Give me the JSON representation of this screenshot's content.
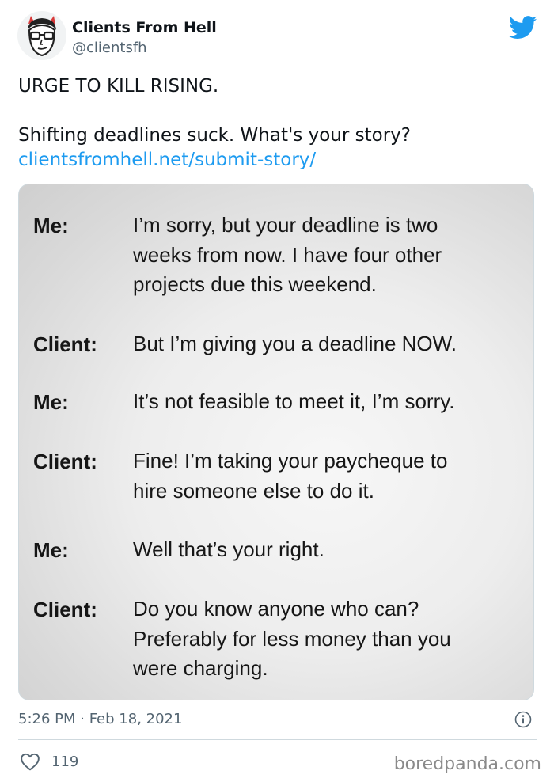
{
  "author": {
    "display_name": "Clients From Hell",
    "handle": "@clientsfh",
    "avatar_icon": "avatar-cartoon-face-with-horns",
    "platform_icon": "twitter-bird-icon",
    "accent_color": "#1d9bf0"
  },
  "tweet": {
    "line1": "URGE TO KILL RISING.",
    "line2": "Shifting deadlines suck. What's your story?",
    "link": "clientsfromhell.net/submit-story/"
  },
  "conversation": [
    {
      "speaker": "Me:",
      "lines": [
        "I’m sorry, but your deadline is two",
        "weeks from now. I have four other",
        "projects due this weekend."
      ]
    },
    {
      "speaker": "Client:",
      "lines": [
        "But I’m giving you a deadline NOW."
      ]
    },
    {
      "speaker": "Me:",
      "lines": [
        "It’s not feasible to meet it, I’m sorry."
      ]
    },
    {
      "speaker": "Client:",
      "lines": [
        "Fine! I’m taking your paycheque to",
        "hire someone else to do it."
      ]
    },
    {
      "speaker": "Me:",
      "lines": [
        "Well that’s your right."
      ]
    },
    {
      "speaker": "Client:",
      "lines": [
        "Do you know anyone who can?",
        "Preferably for less money than you",
        "were charging."
      ]
    }
  ],
  "footer": {
    "timestamp": "5:26 PM · Feb 18, 2021",
    "info_icon": "info-icon",
    "like_icon": "heart-icon",
    "like_count": "119",
    "watermark": "boredpanda.com"
  }
}
